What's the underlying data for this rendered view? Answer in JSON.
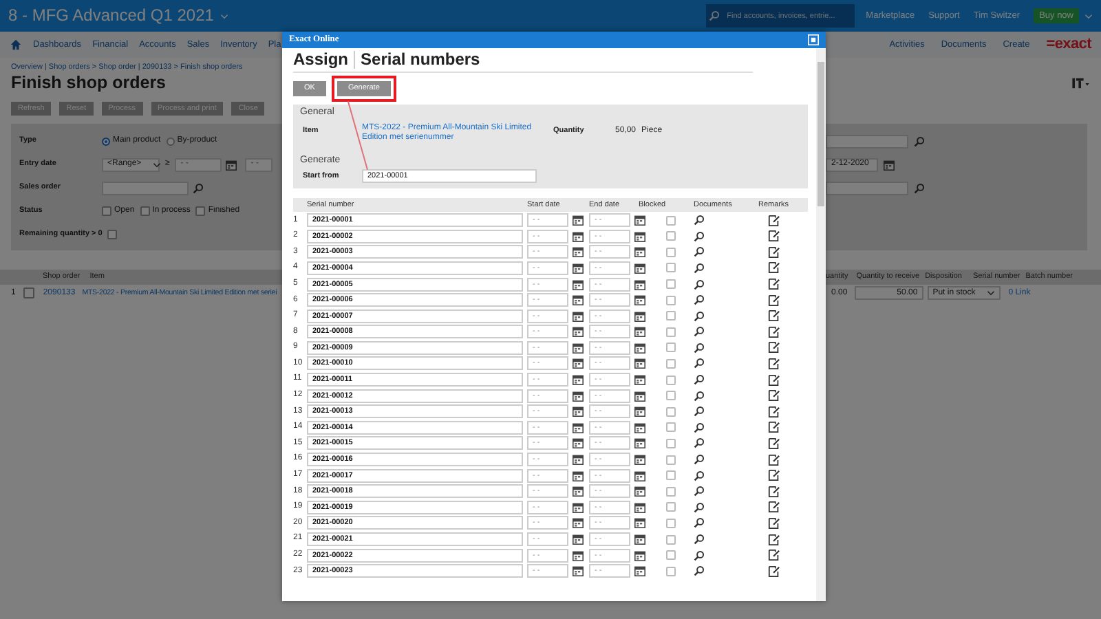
{
  "top_bar": {
    "title": "8 - MFG Advanced Q1 2021",
    "search": {
      "placeholder": "Find accounts, invoices, entrie..."
    },
    "links": [
      "Marketplace",
      "Support",
      "Tim Switzer"
    ],
    "buy_button": "Buy now"
  },
  "nav": {
    "items": [
      "Dashboards",
      "Financial",
      "Accounts",
      "Sales",
      "Inventory",
      "Pla"
    ],
    "right_items": [
      "Activities",
      "Documents",
      "Create"
    ],
    "logo": "=exact"
  },
  "page": {
    "breadcrumb": "Overview | Shop orders > Shop order | 2090133 > Finish shop orders",
    "title": "Finish shop orders",
    "buttons": [
      "Refresh",
      "Reset",
      "Process",
      "Process and print",
      "Close"
    ],
    "filters": {
      "type": {
        "label": "Type",
        "options": [
          {
            "label": "Main product",
            "selected": true
          },
          {
            "label": "By-product",
            "selected": false
          }
        ]
      },
      "entry_date": {
        "label": "Entry date",
        "range": "<Range>",
        "operator": "≥",
        "from": "- -",
        "to": "- -",
        "end": "2-12-2020"
      },
      "sales_order": {
        "label": "Sales order"
      },
      "status": {
        "label": "Status",
        "options": [
          {
            "label": "Open",
            "checked": false
          },
          {
            "label": "In process",
            "checked": false
          },
          {
            "label": "Finished",
            "checked": false
          }
        ]
      },
      "remaining": {
        "label": "Remaining quantity > 0",
        "checked": false
      }
    },
    "table": {
      "columns": [
        "Shop order",
        "Item",
        "uantity",
        "Quantity to receive",
        "Disposition",
        "Serial number",
        "Batch number"
      ],
      "rows": [
        {
          "number": "1",
          "shop_order": "2090133",
          "item": "MTS-2022 - Premium All-Mountain Ski Limited Edition met seriei",
          "column_3": "0.00",
          "quantity_to_receive": "50.00",
          "disposition": "Put in stock",
          "serial_number": "0 Link"
        }
      ]
    }
  },
  "dialog": {
    "window_title": "Exact Online",
    "title_prefix": "Assign",
    "title": "Serial numbers",
    "buttons": [
      {
        "label": "OK",
        "highlighted": false
      },
      {
        "label": "Generate",
        "highlighted": true
      }
    ],
    "general": {
      "heading": "General",
      "item_label": "Item",
      "item_value": "MTS-2022 - Premium All-Mountain Ski Limited Edition met serienummer",
      "quantity_label": "Quantity",
      "quantity_value": "50,00",
      "unit": "Piece"
    },
    "generate": {
      "heading": "Generate",
      "start_from_label": "Start from",
      "start_from_value": "2021-00001"
    },
    "columns": [
      "Serial number",
      "Start date",
      "End date",
      "Blocked",
      "Documents",
      "Remarks"
    ],
    "rows": [
      {
        "number": "1",
        "serial": "2021-00001",
        "start_date": "- -",
        "end_date": "- -",
        "blocked": false
      },
      {
        "number": "2",
        "serial": "2021-00002",
        "start_date": "- -",
        "end_date": "- -",
        "blocked": false
      },
      {
        "number": "3",
        "serial": "2021-00003",
        "start_date": "- -",
        "end_date": "- -",
        "blocked": false
      },
      {
        "number": "4",
        "serial": "2021-00004",
        "start_date": "- -",
        "end_date": "- -",
        "blocked": false
      },
      {
        "number": "5",
        "serial": "2021-00005",
        "start_date": "- -",
        "end_date": "- -",
        "blocked": false
      },
      {
        "number": "6",
        "serial": "2021-00006",
        "start_date": "- -",
        "end_date": "- -",
        "blocked": false
      },
      {
        "number": "7",
        "serial": "2021-00007",
        "start_date": "- -",
        "end_date": "- -",
        "blocked": false
      },
      {
        "number": "8",
        "serial": "2021-00008",
        "start_date": "- -",
        "end_date": "- -",
        "blocked": false
      },
      {
        "number": "9",
        "serial": "2021-00009",
        "start_date": "- -",
        "end_date": "- -",
        "blocked": false
      },
      {
        "number": "10",
        "serial": "2021-00010",
        "start_date": "- -",
        "end_date": "- -",
        "blocked": false
      },
      {
        "number": "11",
        "serial": "2021-00011",
        "start_date": "- -",
        "end_date": "- -",
        "blocked": false
      },
      {
        "number": "12",
        "serial": "2021-00012",
        "start_date": "- -",
        "end_date": "- -",
        "blocked": false
      },
      {
        "number": "13",
        "serial": "2021-00013",
        "start_date": "- -",
        "end_date": "- -",
        "blocked": false
      },
      {
        "number": "14",
        "serial": "2021-00014",
        "start_date": "- -",
        "end_date": "- -",
        "blocked": false
      },
      {
        "number": "15",
        "serial": "2021-00015",
        "start_date": "- -",
        "end_date": "- -",
        "blocked": false
      },
      {
        "number": "16",
        "serial": "2021-00016",
        "start_date": "- -",
        "end_date": "- -",
        "blocked": false
      },
      {
        "number": "17",
        "serial": "2021-00017",
        "start_date": "- -",
        "end_date": "- -",
        "blocked": false
      },
      {
        "number": "18",
        "serial": "2021-00018",
        "start_date": "- -",
        "end_date": "- -",
        "blocked": false
      },
      {
        "number": "19",
        "serial": "2021-00019",
        "start_date": "- -",
        "end_date": "- -",
        "blocked": false
      },
      {
        "number": "20",
        "serial": "2021-00020",
        "start_date": "- -",
        "end_date": "- -",
        "blocked": false
      },
      {
        "number": "21",
        "serial": "2021-00021",
        "start_date": "- -",
        "end_date": "- -",
        "blocked": false
      },
      {
        "number": "22",
        "serial": "2021-00022",
        "start_date": "- -",
        "end_date": "- -",
        "blocked": false
      },
      {
        "number": "23",
        "serial": "2021-00023",
        "start_date": "- -",
        "end_date": "- -",
        "blocked": false
      }
    ]
  }
}
